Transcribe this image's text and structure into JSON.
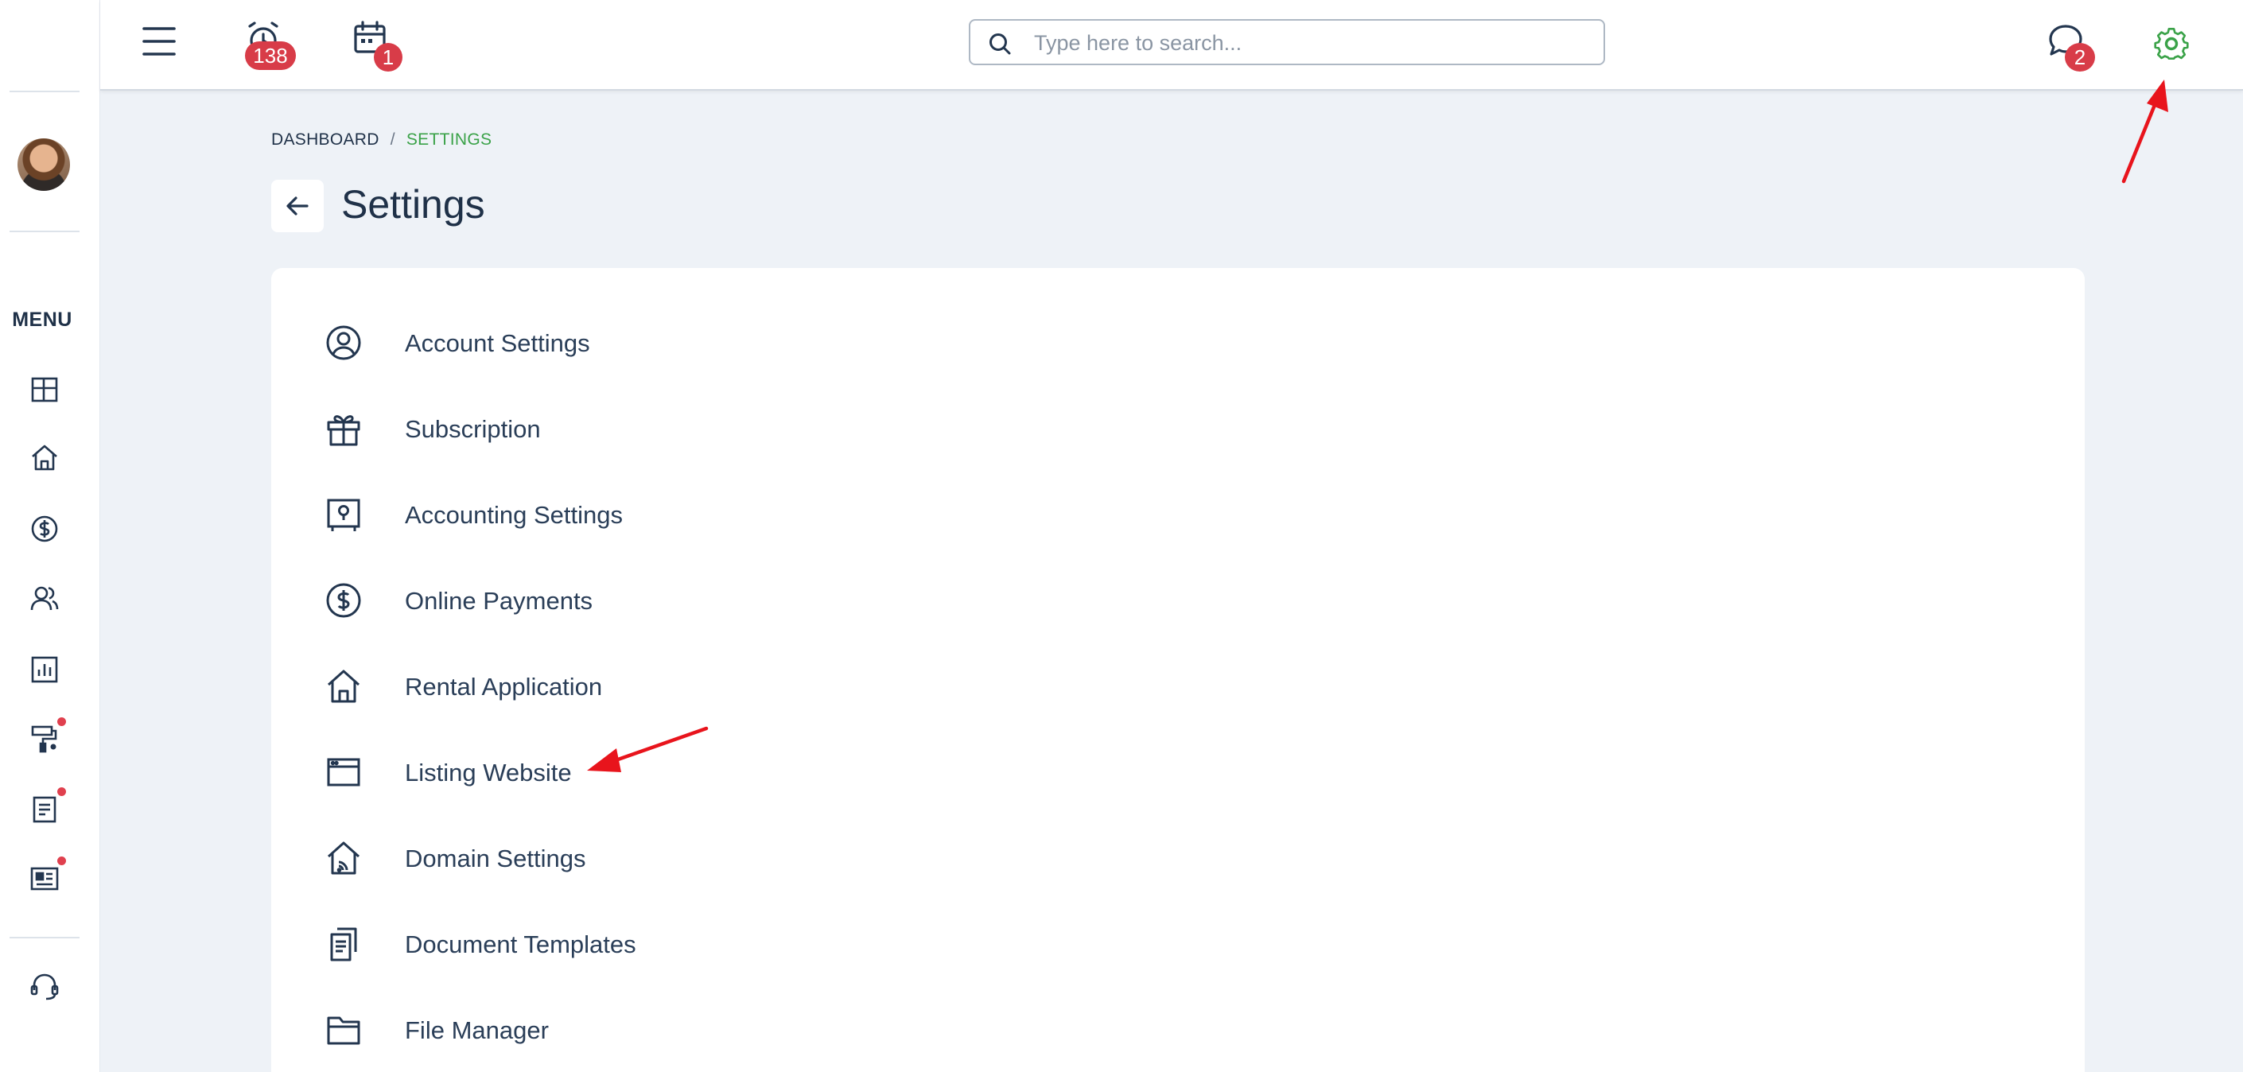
{
  "topbar": {
    "timer_badge": "138",
    "calendar_badge": "1",
    "messages_badge": "2",
    "search": {
      "placeholder": "Type here to search..."
    }
  },
  "sidebar": {
    "menu_label": "MENU",
    "items": [
      {
        "icon": "dashboard-icon"
      },
      {
        "icon": "home-icon"
      },
      {
        "icon": "dollar-circle-icon"
      },
      {
        "icon": "users-icon"
      },
      {
        "icon": "report-chart-icon"
      },
      {
        "icon": "paint-roller-icon",
        "has_notification": true
      },
      {
        "icon": "document-icon",
        "has_notification": true
      },
      {
        "icon": "news-icon",
        "has_notification": true
      },
      {
        "icon": "headset-icon"
      }
    ]
  },
  "breadcrumb": {
    "home": "DASHBOARD",
    "separator": "/",
    "current": "SETTINGS"
  },
  "page": {
    "title": "Settings"
  },
  "settings": [
    {
      "label": "Account Settings",
      "icon": "user-circle-icon"
    },
    {
      "label": "Subscription",
      "icon": "gift-icon"
    },
    {
      "label": "Accounting Settings",
      "icon": "safe-icon"
    },
    {
      "label": "Online Payments",
      "icon": "dollar-circle-icon"
    },
    {
      "label": "Rental Application",
      "icon": "home-icon"
    },
    {
      "label": "Listing Website",
      "icon": "browser-window-icon"
    },
    {
      "label": "Domain Settings",
      "icon": "home-wifi-icon"
    },
    {
      "label": "Document Templates",
      "icon": "documents-icon"
    },
    {
      "label": "File Manager",
      "icon": "folder-icon"
    }
  ],
  "colors": {
    "accent_green": "#3aa248",
    "badge_red": "#d83c48",
    "annotation_red": "#e8141c",
    "background": "#eef2f7"
  }
}
